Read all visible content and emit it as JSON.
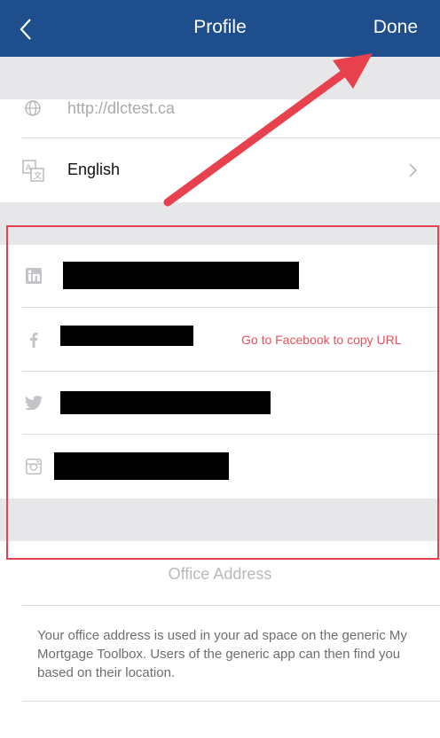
{
  "navbar": {
    "title": "Profile",
    "done_label": "Done",
    "back_icon": "chevron-left-icon",
    "background": "#1f4e8d"
  },
  "profile": {
    "website": {
      "icon": "globe-icon",
      "value": "http://dlctest.ca"
    },
    "language": {
      "icon": "translate-icon",
      "value": "English",
      "chevron_icon": "chevron-right-icon"
    }
  },
  "social": {
    "linkedin": {
      "icon": "linkedin-icon"
    },
    "facebook": {
      "icon": "facebook-icon",
      "action": "Go to Facebook to copy URL"
    },
    "twitter": {
      "icon": "twitter-icon"
    },
    "instagram": {
      "icon": "instagram-icon"
    }
  },
  "office": {
    "label": "Office Address",
    "description": "Your office address is used in your ad space on the generic My Mortgage Toolbox. Users of the generic app can then find you based on their location."
  },
  "annotation": {
    "color": "#e8414e",
    "shapes": [
      "highlight-box",
      "arrow"
    ]
  }
}
